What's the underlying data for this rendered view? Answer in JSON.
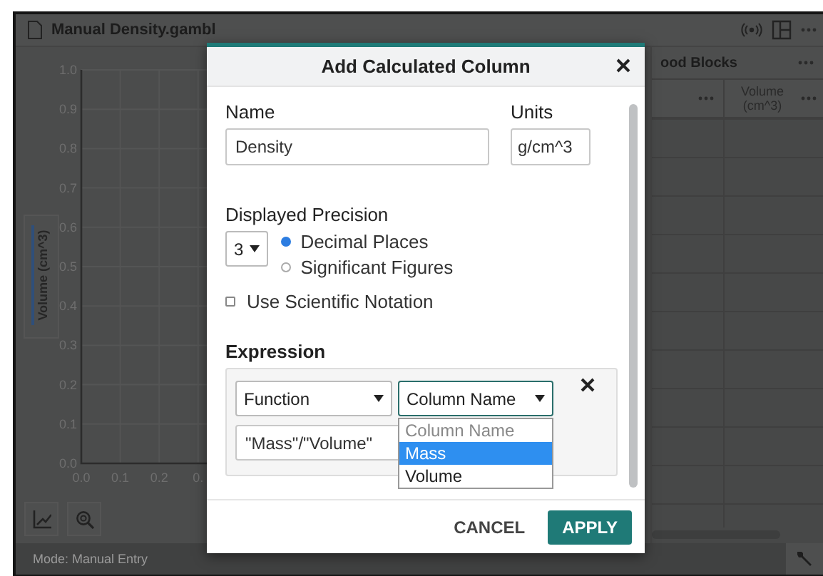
{
  "app": {
    "title": "Manual Density.gambl",
    "status": "Mode: Manual Entry"
  },
  "graph": {
    "chart_data": {
      "type": "line",
      "grid": true,
      "ylabel": "Volume (cm^3)",
      "xlim": [
        0,
        1.4
      ],
      "ylim": [
        0,
        1
      ],
      "xticks": [
        {
          "value": 0,
          "label": "0.0"
        },
        {
          "value": 0.1,
          "label": "0.1"
        },
        {
          "value": 0.2,
          "label": "0.2"
        },
        {
          "value": 0.3,
          "label": "0."
        }
      ],
      "yticks": [
        {
          "value": 0,
          "label": "0.0"
        },
        {
          "value": 0.1,
          "label": "0.1"
        },
        {
          "value": 0.2,
          "label": "0.2"
        },
        {
          "value": 0.3,
          "label": "0.3"
        },
        {
          "value": 0.4,
          "label": "0.4"
        },
        {
          "value": 0.5,
          "label": "0.5"
        },
        {
          "value": 0.6,
          "label": "0.6"
        },
        {
          "value": 0.7,
          "label": "0.7"
        },
        {
          "value": 0.8,
          "label": "0.8"
        },
        {
          "value": 0.9,
          "label": "0.9"
        },
        {
          "value": 1,
          "label": "1.0"
        }
      ]
    }
  },
  "table": {
    "title": "ood Blocks",
    "columns": [
      {
        "label": "Volume (cm^3)"
      }
    ]
  },
  "dialog": {
    "title": "Add Calculated Column",
    "name": {
      "label": "Name",
      "value": "Density"
    },
    "units": {
      "label": "Units",
      "value": "g/cm^3"
    },
    "precision": {
      "label": "Displayed Precision",
      "digits": "3",
      "options": [
        {
          "label": "Decimal Places",
          "selected": true
        },
        {
          "label": "Significant Figures",
          "selected": false
        }
      ]
    },
    "scientific": {
      "label": "Use Scientific Notation",
      "checked": false
    },
    "expression": {
      "label": "Expression",
      "type_select": "Function",
      "column_select": "Column Name",
      "value": "\"Mass\"/\"Volume\"",
      "column_options": [
        {
          "label": "Column Name",
          "kind": "placeholder",
          "selected": false
        },
        {
          "label": "Mass",
          "kind": "option",
          "selected": true
        },
        {
          "label": "Volume",
          "kind": "option",
          "selected": false
        }
      ]
    },
    "buttons": [
      {
        "label": "CANCEL",
        "kind": "text"
      },
      {
        "label": "APPLY",
        "kind": "primary"
      }
    ]
  }
}
